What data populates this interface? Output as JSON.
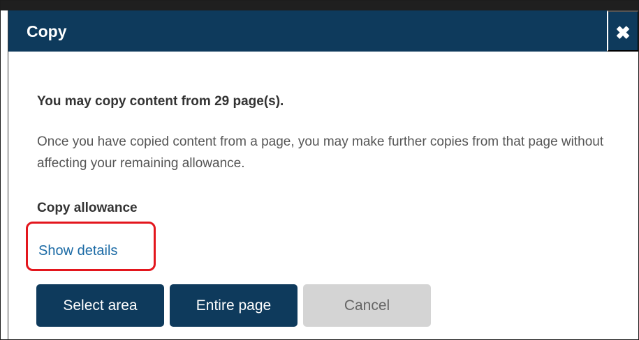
{
  "dialog": {
    "title": "Copy",
    "close_label": "✖",
    "headline": "You may copy content from 29 page(s).",
    "body_text": "Once you have copied content from a page, you may make further copies from that page without affecting your remaining allowance.",
    "allowance_label": "Copy allowance",
    "show_details_link": "Show details",
    "buttons": {
      "select_area": "Select area",
      "entire_page": "Entire page",
      "cancel": "Cancel"
    }
  },
  "colors": {
    "primary": "#0e3a5c",
    "link": "#1b6aa5",
    "highlight": "#e3161d",
    "cancel_bg": "#d4d4d4"
  }
}
